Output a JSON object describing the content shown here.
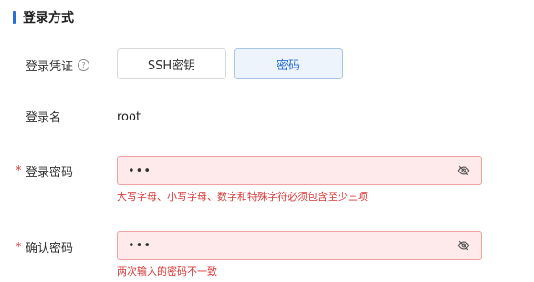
{
  "section": {
    "title": "登录方式"
  },
  "credential": {
    "label": "登录凭证",
    "help_icon": "question-circle-icon",
    "options": [
      {
        "label": "SSH密钥",
        "selected": false
      },
      {
        "label": "密码",
        "selected": true
      }
    ]
  },
  "login_name": {
    "label": "登录名",
    "value": "root"
  },
  "password": {
    "label": "登录密码",
    "required_mark": "*",
    "value": "•••",
    "toggle_icon": "eye-off-icon",
    "error": "大写字母、小写字母、数字和特殊字符必须包含至少三项"
  },
  "confirm_password": {
    "label": "确认密码",
    "required_mark": "*",
    "value": "•••",
    "toggle_icon": "eye-off-icon",
    "error": "两次输入的密码不一致"
  },
  "colors": {
    "accent": "#2a6fd6",
    "error": "#d83b3b",
    "error_bg": "#feeaea",
    "error_border": "#f0a3a3"
  }
}
